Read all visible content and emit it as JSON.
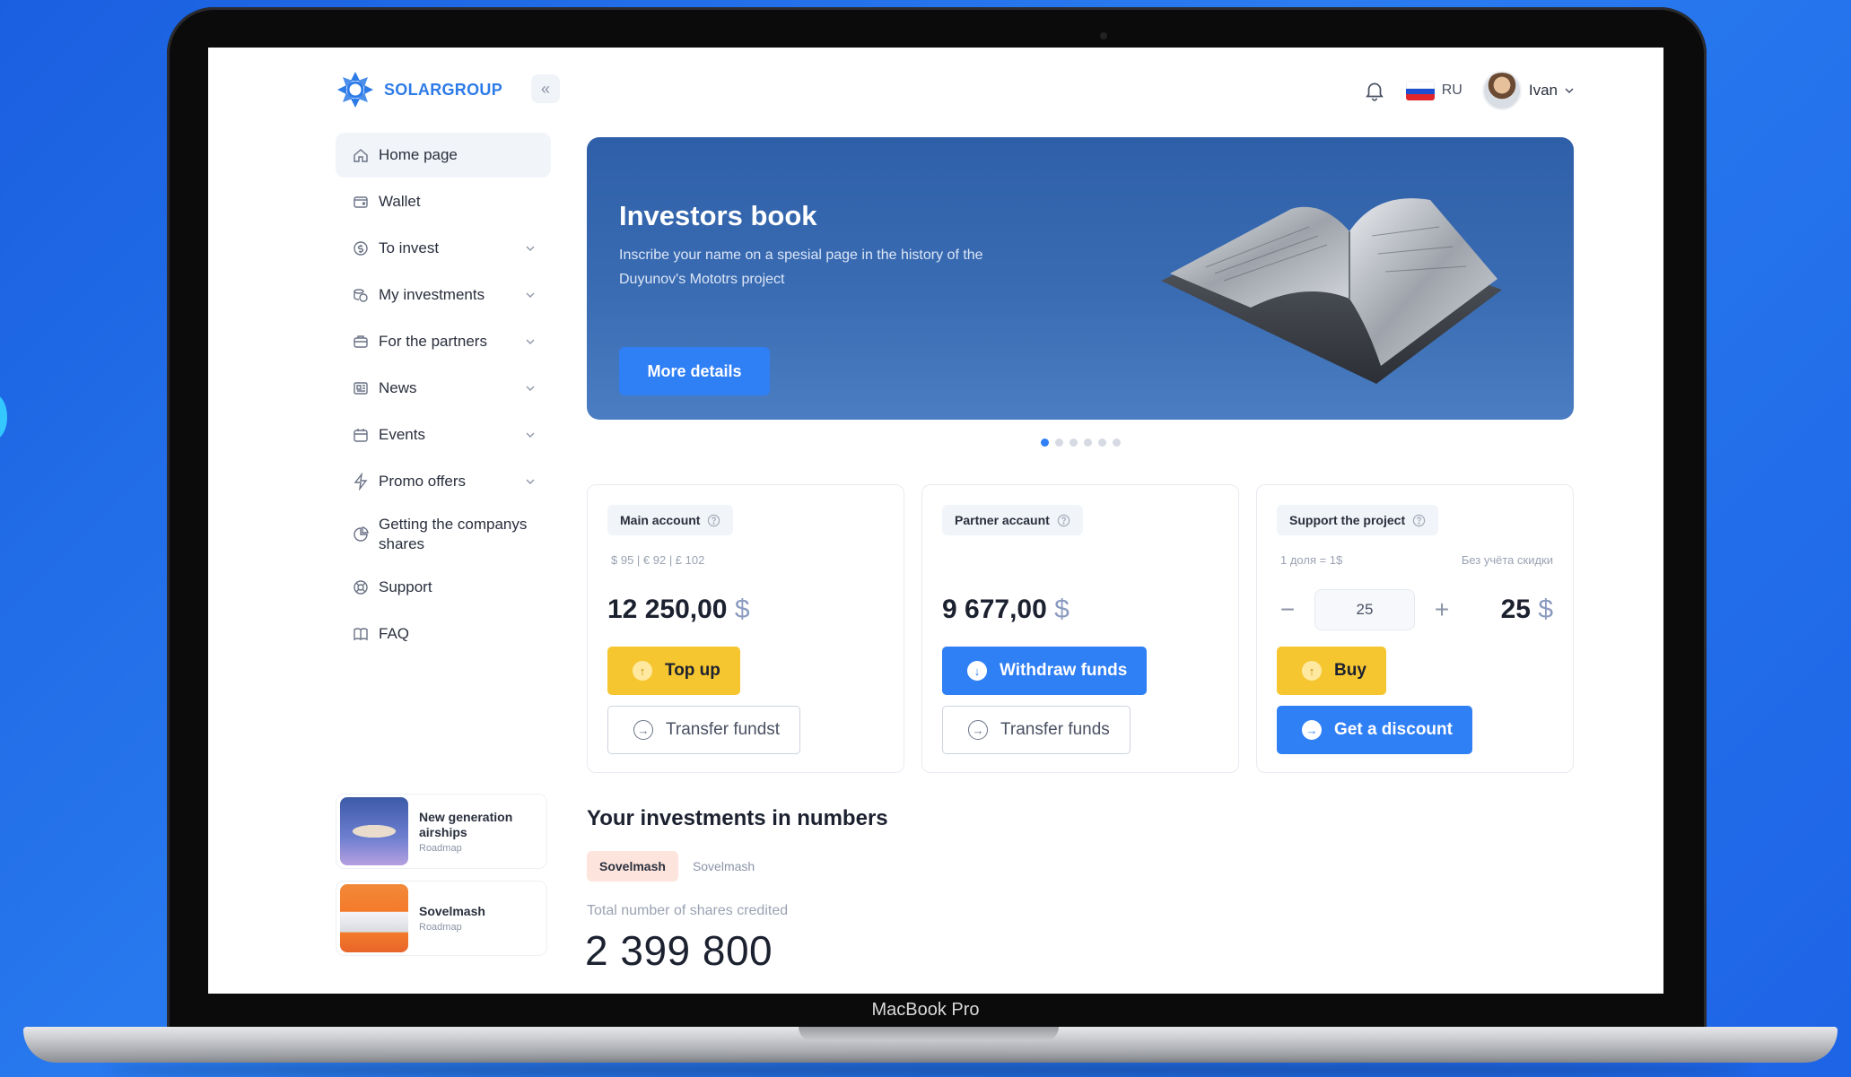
{
  "app": {
    "brand": "SOLARGROUP",
    "device_label": "MacBook Pro"
  },
  "header": {
    "language": "RU",
    "user_name": "Ivan"
  },
  "sidebar": {
    "items": [
      {
        "label": "Home page",
        "icon": "home-icon",
        "has_submenu": false,
        "active": true
      },
      {
        "label": "Wallet",
        "icon": "wallet-icon",
        "has_submenu": false
      },
      {
        "label": "To invest",
        "icon": "coin-icon",
        "has_submenu": true
      },
      {
        "label": "My investments",
        "icon": "coins-stack-icon",
        "has_submenu": true
      },
      {
        "label": "For the partners",
        "icon": "briefcase-icon",
        "has_submenu": true
      },
      {
        "label": "News",
        "icon": "newspaper-icon",
        "has_submenu": true
      },
      {
        "label": "Events",
        "icon": "calendar-icon",
        "has_submenu": true
      },
      {
        "label": "Promo offers",
        "icon": "lightning-icon",
        "has_submenu": true
      },
      {
        "label": "Getting the companys shares",
        "icon": "pie-chart-icon",
        "has_submenu": false
      },
      {
        "label": "Support",
        "icon": "lifebuoy-icon",
        "has_submenu": false
      },
      {
        "label": "FAQ",
        "icon": "book-icon",
        "has_submenu": false
      }
    ],
    "projects": [
      {
        "title": "New generation airships",
        "subtitle": "Roadmap"
      },
      {
        "title": "Sovelmash",
        "subtitle": "Roadmap"
      }
    ]
  },
  "banner": {
    "title": "Investors book",
    "text": "Inscribe your name on a spesial page in the history of the Duyunov's Mototrs project",
    "button": "More details",
    "slide_count": 6,
    "active_slide": 1
  },
  "cards": {
    "main": {
      "title": "Main account",
      "rates": "$ 95 | € 92 | £ 102",
      "amount": "12 250,00",
      "currency": "$",
      "primary_button": "Top up",
      "secondary_button": "Transfer fundst"
    },
    "partner": {
      "title": "Partner accaunt",
      "amount": "9 677,00",
      "currency": "$",
      "primary_button": "Withdraw funds",
      "secondary_button": "Transfer funds"
    },
    "support": {
      "title": "Support the project",
      "share_rate": "1 доля = 1$",
      "discount_note": "Без учёта скидки",
      "quantity": "25",
      "total": "25",
      "currency": "$",
      "primary_button": "Buy",
      "secondary_button": "Get a discount",
      "minus": "−",
      "plus": "+"
    }
  },
  "investments": {
    "title": "Your investments in numbers",
    "tabs": [
      {
        "label": "Sovelmash",
        "active": true
      },
      {
        "label": "Sovelmash",
        "active": false
      }
    ],
    "metric_label": "Total number of shares credited",
    "metric_value": "2 399 800"
  },
  "colors": {
    "accent_blue": "#2f7ff5",
    "accent_yellow": "#f6c630",
    "brand_blue": "#2d7be8",
    "background_blue": "#1d64e6"
  }
}
